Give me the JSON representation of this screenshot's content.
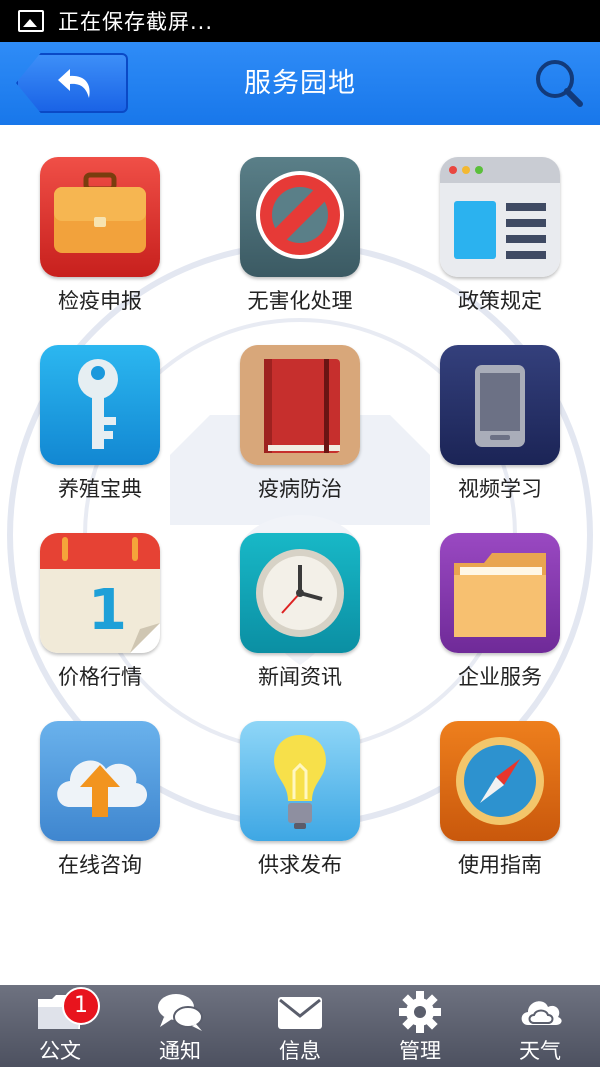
{
  "status_bar": {
    "text": "正在保存截屏..."
  },
  "header": {
    "title": "服务园地"
  },
  "grid": [
    {
      "label": "检疫申报",
      "icon": "briefcase-icon"
    },
    {
      "label": "无害化处理",
      "icon": "prohibited-icon"
    },
    {
      "label": "政策规定",
      "icon": "browser-window-icon"
    },
    {
      "label": "养殖宝典",
      "icon": "key-icon"
    },
    {
      "label": "疫病防治",
      "icon": "notebook-icon"
    },
    {
      "label": "视频学习",
      "icon": "phone-icon"
    },
    {
      "label": "价格行情",
      "icon": "calendar-icon"
    },
    {
      "label": "新闻资讯",
      "icon": "clock-icon"
    },
    {
      "label": "企业服务",
      "icon": "folder-icon"
    },
    {
      "label": "在线咨询",
      "icon": "cloud-upload-icon"
    },
    {
      "label": "供求发布",
      "icon": "lightbulb-icon"
    },
    {
      "label": "使用指南",
      "icon": "compass-icon"
    }
  ],
  "bottom_bar": {
    "tabs": [
      {
        "label": "公文",
        "icon": "folder-icon",
        "badge": "1"
      },
      {
        "label": "通知",
        "icon": "chat-bubbles-icon"
      },
      {
        "label": "信息",
        "icon": "envelope-icon"
      },
      {
        "label": "管理",
        "icon": "gear-icon"
      },
      {
        "label": "天气",
        "icon": "cloud-icon"
      }
    ]
  },
  "colors": {
    "header_blue": "#1877ea",
    "bottom_bar": "#5a5e6c",
    "badge_red": "#e8141d"
  }
}
